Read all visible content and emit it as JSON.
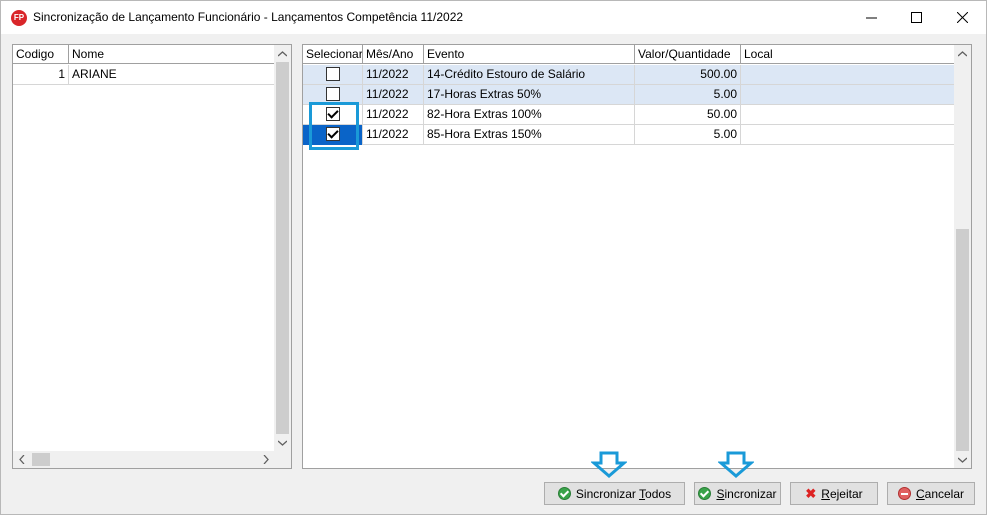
{
  "window": {
    "title": "Sincronização de Lançamento Funcionário - Lançamentos Competência 11/2022",
    "app_icon_text": "FP"
  },
  "left_grid": {
    "columns": [
      "Codigo",
      "Nome"
    ],
    "rows": [
      {
        "codigo": "1",
        "nome": "ARIANE"
      }
    ]
  },
  "right_grid": {
    "columns": [
      "Selecionar",
      "Mês/Ano",
      "Evento",
      "Valor/Quantidade",
      "Local"
    ],
    "rows": [
      {
        "selected": false,
        "mes_ano": "11/2022",
        "evento": "14-Crédito Estouro de Salário",
        "valor": "500.00",
        "local": ""
      },
      {
        "selected": false,
        "mes_ano": "11/2022",
        "evento": "17-Horas Extras 50%",
        "valor": "5.00",
        "local": ""
      },
      {
        "selected": true,
        "mes_ano": "11/2022",
        "evento": "82-Hora Extras 100%",
        "valor": "50.00",
        "local": ""
      },
      {
        "selected": true,
        "mes_ano": "11/2022",
        "evento": "85-Hora Extras 150%",
        "valor": "5.00",
        "local": ""
      }
    ]
  },
  "buttons": {
    "sync_all_pre": "Sincronizar ",
    "sync_all_u": "T",
    "sync_all_post": "odos",
    "sync_u": "S",
    "sync_post": "incronizar",
    "reject_u": "R",
    "reject_post": "ejeitar",
    "cancel_u": "C",
    "cancel_post": "ancelar"
  },
  "colors": {
    "accent": "#1a9ad8",
    "row_highlight": "#dce7f5",
    "selected_cell": "#0a64c8"
  }
}
